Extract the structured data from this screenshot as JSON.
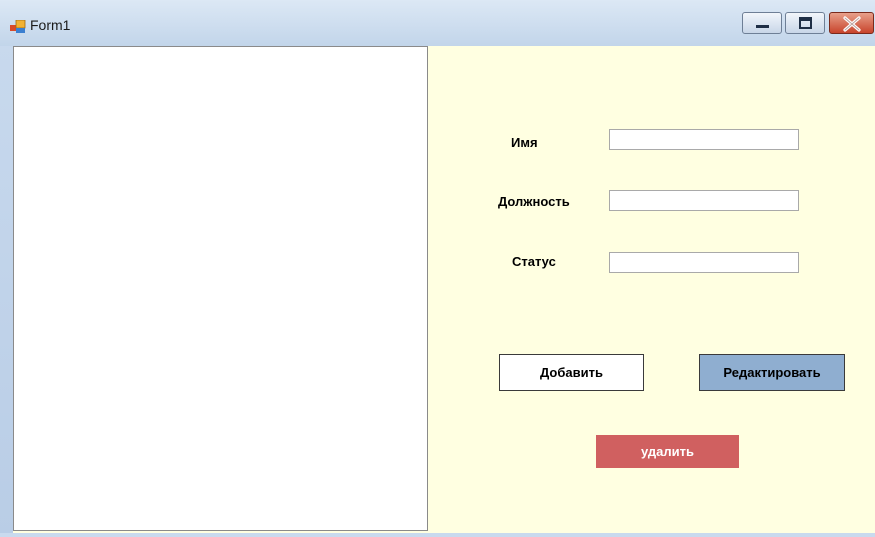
{
  "window": {
    "title": "Form1",
    "controls": {
      "minimize": "minimize",
      "maximize": "maximize",
      "close": "close"
    }
  },
  "form": {
    "name_label": "Имя",
    "position_label": "Должность",
    "status_label": "Статус",
    "name_value": "",
    "position_value": "",
    "status_value": ""
  },
  "buttons": {
    "add": "Добавить",
    "edit": "Редактировать",
    "delete": "удалить"
  },
  "colors": {
    "client_bg": "#ffffe1",
    "edit_button": "#8faed0",
    "delete_button": "#d06060"
  }
}
